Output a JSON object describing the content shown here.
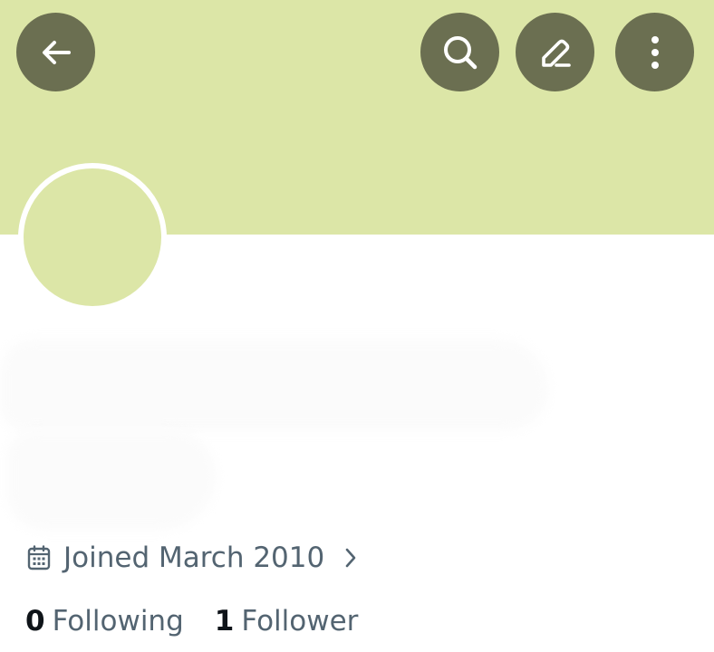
{
  "colors": {
    "banner": "#dce6a7",
    "icon_button_bg": "#6b6f51",
    "icon_fg": "#ffffff",
    "avatar": "#dce6a7",
    "secondary_text": "#536471",
    "primary_text": "#0f1419"
  },
  "header": {
    "back_icon": "arrow-left-icon",
    "search_icon": "search-icon",
    "edit_icon": "pencil-icon",
    "more_icon": "more-vertical-icon"
  },
  "profile": {
    "joined": {
      "icon": "calendar-icon",
      "text": "Joined March 2010",
      "chevron_icon": "chevron-right-icon"
    },
    "following": {
      "count": "0",
      "label": "Following"
    },
    "followers": {
      "count": "1",
      "label": "Follower"
    }
  }
}
